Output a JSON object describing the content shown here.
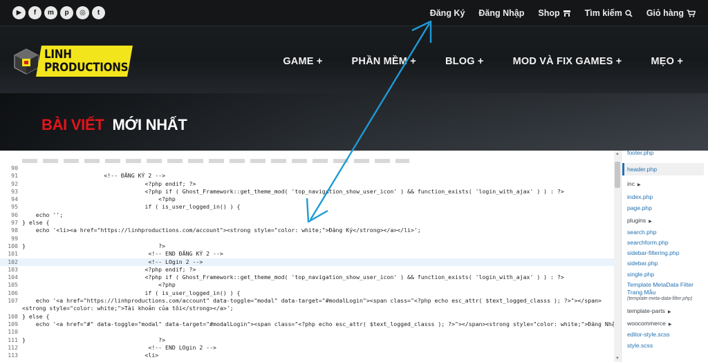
{
  "social_icons": [
    "youtube-icon",
    "facebook-icon",
    "messenger-icon",
    "pinterest-icon",
    "instagram-icon",
    "twitter-icon"
  ],
  "social_glyphs": [
    "▶",
    "f",
    "m",
    "p",
    "◎",
    "t"
  ],
  "topbar": {
    "register": "Đăng Ký",
    "login": "Đăng Nhập",
    "shop": "Shop",
    "search": "Tìm kiếm",
    "cart": "Giỏ hàng"
  },
  "logo": {
    "line1": "LINH",
    "line2": "PRODUCTIONS"
  },
  "nav": [
    "GAME +",
    "PHẦN MỀM +",
    "BLOG +",
    "MOD VÀ FIX GAMES +",
    "MẸO +"
  ],
  "banner": {
    "red": "BÀI VIẾT",
    "white": "MỚI NHẤT"
  },
  "colors": {
    "accent_red": "#e3141b",
    "logo_yellow": "#f3e51b",
    "arrow_blue": "#1e9ad6",
    "link_blue": "#2271b1"
  },
  "code_lines": [
    {
      "n": "90",
      "t": ""
    },
    {
      "n": "91",
      "t": "                        <!-- ĐĂNG KÝ 2 -->"
    },
    {
      "n": "92",
      "t": "                                    <?php endif; ?>"
    },
    {
      "n": "93",
      "t": "                                    <?php if ( Ghost_Framework::get_theme_mod( 'top_navigation_show_user_icon' ) && function_exists( 'login_with_ajax' ) ) : ?>"
    },
    {
      "n": "94",
      "t": "                                        <?php"
    },
    {
      "n": "95",
      "t": "                                    if ( is_user_logged_in() ) {"
    },
    {
      "n": "96",
      "t": "    echo '';"
    },
    {
      "n": "97",
      "t": "} else {"
    },
    {
      "n": "98",
      "t": "    echo '<li><a href=\"https://linhproductions.com/account\"><strong style=\"color: white;\">Đăng Ký</strong></a></li>';"
    },
    {
      "n": "99",
      "t": ""
    },
    {
      "n": "100",
      "t": "}                                       ?>"
    },
    {
      "n": "101",
      "t": "                                     <!-- END ĐĂNG KÝ 2 -->"
    },
    {
      "n": "102",
      "t": "                                     <!-- LOgin 2 -->"
    },
    {
      "n": "103",
      "t": "                                    <?php endif; ?>"
    },
    {
      "n": "104",
      "t": "                                    <?php if ( Ghost_Framework::get_theme_mod( 'top_navigation_show_user_icon' ) && function_exists( 'login_with_ajax' ) ) : ?>"
    },
    {
      "n": "105",
      "t": "                                        <?php"
    },
    {
      "n": "106",
      "t": "                                    if ( is_user_logged_in() ) {"
    },
    {
      "n": "107",
      "t": "    echo '<a href=\"https://linhproductions.com/account\" data-toggle=\"modal\" data-target=\"#modalLogin\"><span class=\"<?php echo esc_attr( $text_logged_classs ); ?>\"></span><strong style=\"color: white;\">Tài khoản của tôi</strong></a>';"
    },
    {
      "n": "108",
      "t": "} else {"
    },
    {
      "n": "109",
      "t": "    echo '<a href=\"#\" data-toggle=\"modal\" data-target=\"#modalLogin\"><span class=\"<?php echo esc_attr( $text_logged_classs ); ?>\"></span><strong style=\"color: white;\">Đăng Nhập</strong></a>';"
    },
    {
      "n": "110",
      "t": ""
    },
    {
      "n": "111",
      "t": "}                                       ?>"
    },
    {
      "n": "112",
      "t": "                                     <!-- END LOgin 2 -->"
    },
    {
      "n": "113",
      "t": "                                    <li>"
    }
  ],
  "files": [
    {
      "label": "footer.php",
      "kind": "file"
    },
    {
      "label": "header.php",
      "kind": "active"
    },
    {
      "label": "inc",
      "kind": "folder"
    },
    {
      "label": "index.php",
      "kind": "file"
    },
    {
      "label": "page.php",
      "kind": "file"
    },
    {
      "label": "plugins",
      "kind": "folder"
    },
    {
      "label": "search.php",
      "kind": "file"
    },
    {
      "label": "searchform.php",
      "kind": "file"
    },
    {
      "label": "sidebar-filtering.php",
      "kind": "file"
    },
    {
      "label": "sidebar.php",
      "kind": "file"
    },
    {
      "label": "single.php",
      "kind": "file"
    },
    {
      "label": "Template MetaData Filter",
      "kind": "file"
    },
    {
      "label": "Trang Mẫu",
      "kind": "file"
    },
    {
      "label": "(template-meta-data-filter.php)",
      "kind": "desc"
    },
    {
      "label": "template-parts",
      "kind": "folder"
    },
    {
      "label": "woocommerce",
      "kind": "folder"
    },
    {
      "label": "editor-style.scss",
      "kind": "file"
    },
    {
      "label": "style.scss",
      "kind": "file"
    }
  ]
}
